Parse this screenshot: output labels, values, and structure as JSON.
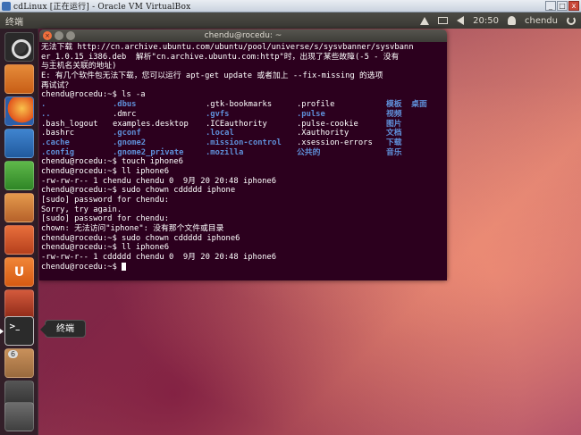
{
  "vbox": {
    "title": "cdLinux [正在运行] - Oracle VM VirtualBox",
    "min_glyph": "_",
    "max_glyph": "□",
    "close_glyph": "x"
  },
  "panel": {
    "window_title": "终端",
    "time": "20:50",
    "user": "chendu"
  },
  "terminal": {
    "title": "chendu@rocedu: ~",
    "intro_lines": [
      "无法下载 http://cn.archive.ubuntu.com/ubuntu/pool/universe/s/sysvbanner/sysvbann",
      "er_1.0.15_i386.deb  解析\"cn.archive.ubuntu.com:http\"时，出现了某些故障(-5 - 没有",
      "与主机名关联的地址)",
      "E: 有几个软件包无法下载，您可以运行 apt-get update 或者加上 --fix-missing 的选项",
      "再试试？",
      "chendu@rocedu:~$ ls -a"
    ],
    "ls_rows": [
      [
        ".",
        ".dbus",
        ".gtk-bookmarks",
        ".profile",
        "模板  桌面"
      ],
      [
        "..",
        ".dmrc",
        ".gvfs",
        ".pulse",
        "视频"
      ],
      [
        ".bash_logout",
        "examples.desktop",
        ".ICEauthority",
        ".pulse-cookie",
        "图片"
      ],
      [
        ".bashrc",
        ".gconf",
        ".local",
        ".Xauthority",
        "文档"
      ],
      [
        ".cache",
        ".gnome2",
        ".mission-control",
        ".xsession-errors",
        "下载"
      ],
      [
        ".config",
        ".gnome2_private",
        ".mozilla",
        "公共的",
        "音乐"
      ]
    ],
    "ls_blue": [
      [
        true,
        true,
        false,
        false,
        true
      ],
      [
        true,
        false,
        true,
        true,
        true
      ],
      [
        false,
        false,
        false,
        false,
        true
      ],
      [
        false,
        true,
        true,
        false,
        true
      ],
      [
        true,
        true,
        true,
        false,
        true
      ],
      [
        true,
        true,
        true,
        true,
        true
      ]
    ],
    "rest_lines": [
      "chendu@rocedu:~$ touch iphone6",
      "chendu@rocedu:~$ ll iphone6",
      "-rw-rw-r-- 1 chendu chendu 0  9月 20 20:48 iphone6",
      "chendu@rocedu:~$ sudo chown cddddd iphone",
      "[sudo] password for chendu:",
      "Sorry, try again.",
      "[sudo] password for chendu:",
      "chown: 无法访问\"iphone\": 没有那个文件或目录",
      "chendu@rocedu:~$ sudo chown cddddd iphone6",
      "chendu@rocedu:~$ ll iphone6",
      "-rw-rw-r-- 1 cddddd chendu 0  9月 20 20:48 iphone6"
    ],
    "prompt": "chendu@rocedu:~$ "
  },
  "launcher": {
    "tooltip": "终端",
    "workspace_badge": "6",
    "ubuntuone_glyph": "U"
  },
  "colors": {
    "terminal_bg": "#2c001e",
    "directory_blue": "#5f8fd9",
    "panel": "#3c3b37"
  }
}
